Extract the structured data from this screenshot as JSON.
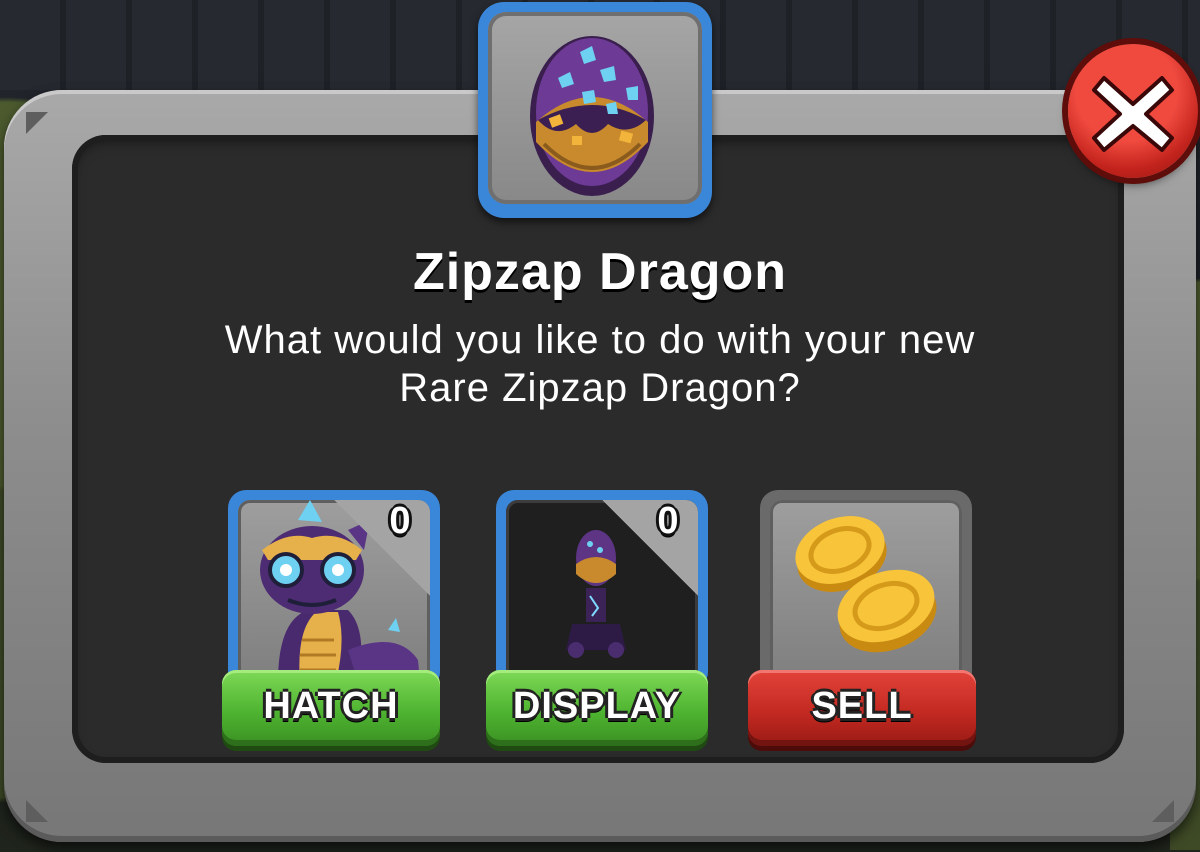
{
  "dialog": {
    "title": "Zipzap Dragon",
    "message_line1": "What would you like to do with your new",
    "message_line2": "Rare Zipzap Dragon?",
    "egg_icon": "purple-crystal-egg-icon",
    "close_icon": "close-x-icon"
  },
  "actions": [
    {
      "label": "HATCH",
      "count": "0",
      "icon": "dragon-portrait-icon",
      "button_color": "#4fb431"
    },
    {
      "label": "DISPLAY",
      "count": "0",
      "icon": "egg-display-stand-icon",
      "button_color": "#4fb431"
    },
    {
      "label": "SELL",
      "icon": "gold-coins-icon",
      "button_color": "#c42a22"
    }
  ],
  "colors": {
    "frame": "#8d8d8d",
    "panel": "#2b2b2b",
    "card_border_active": "#3a86d8",
    "close_button": "#c2231c"
  }
}
